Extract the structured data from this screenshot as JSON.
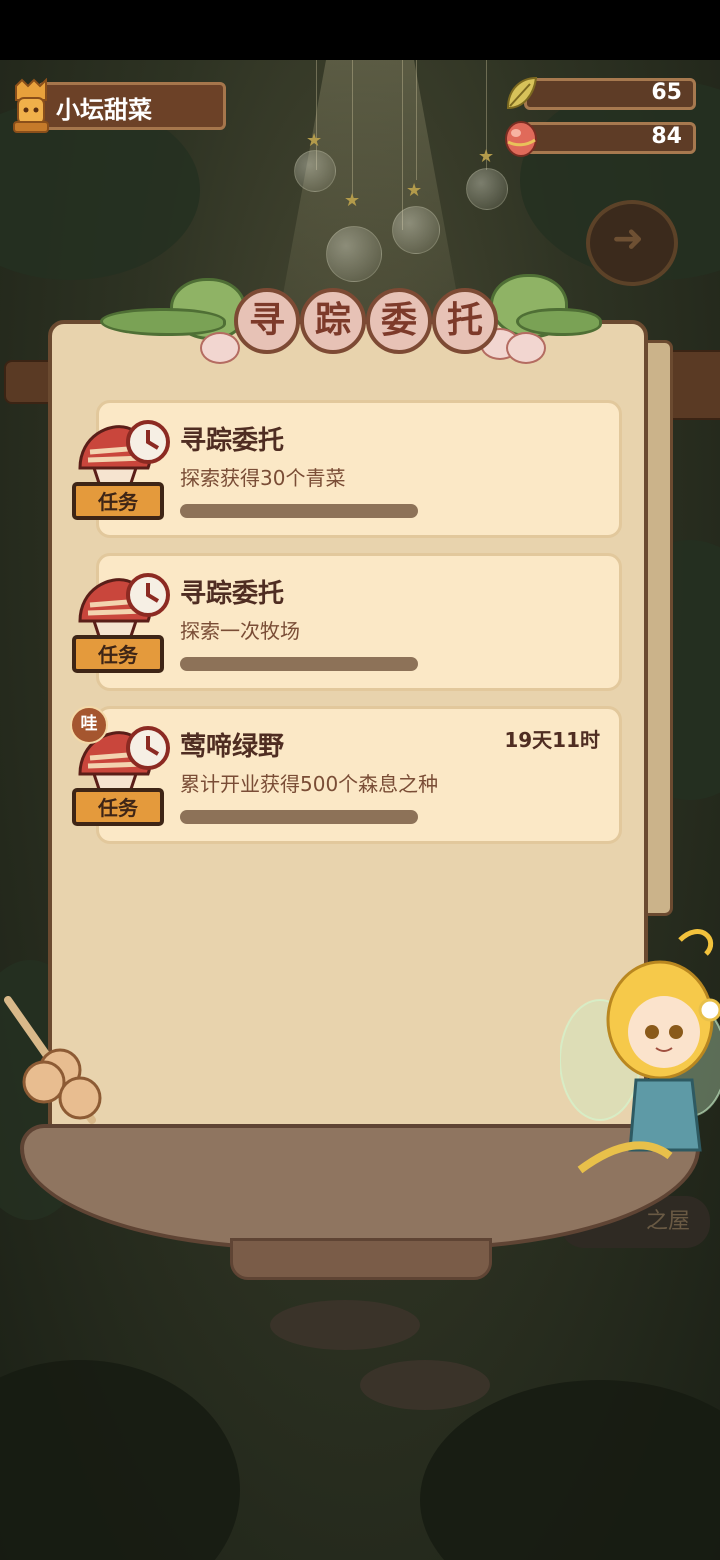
{
  "player": {
    "name": "小坛甜菜"
  },
  "resources": [
    {
      "icon": "leaf-currency-icon",
      "value": "65"
    },
    {
      "icon": "seed-egg-icon",
      "value": "84"
    }
  ],
  "panel": {
    "title_chars": [
      "寻",
      "踪",
      "委",
      "托"
    ]
  },
  "tasks": [
    {
      "title": "寻踪委托",
      "desc": "探索获得30个青菜",
      "badge": "任务",
      "progress": 0,
      "time": "",
      "tag": ""
    },
    {
      "title": "寻踪委托",
      "desc": "探索一次牧场",
      "badge": "任务",
      "progress": 0,
      "time": "",
      "tag": ""
    },
    {
      "title": "莺啼绿野",
      "desc": "累计开业获得500个森息之种",
      "badge": "任务",
      "progress": 0,
      "time": "19天11时",
      "tag": "哇"
    }
  ],
  "scene": {
    "sign_text": "之屋"
  },
  "colors": {
    "board": "#e8d3ad",
    "card": "#fbe8c6",
    "title": "#4f2d22",
    "wood": "#6b4a30"
  }
}
